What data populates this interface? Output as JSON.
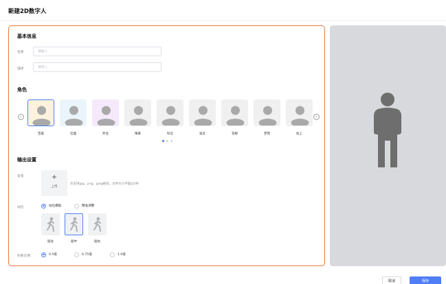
{
  "page": {
    "title": "新建2D数字人"
  },
  "basic_info": {
    "title": "基本信息",
    "name_label": "名称",
    "name_value": "",
    "name_placeholder": "请输入",
    "desc_label": "描述",
    "desc_value": "",
    "desc_placeholder": "请录入"
  },
  "role": {
    "title": "角色",
    "selected": "百富",
    "page_count": 3,
    "active_page": 1,
    "avatars": [
      {
        "label": "百富",
        "bg": "#fdf3dc"
      },
      {
        "label": "云烟",
        "bg": "#eaf4fb"
      },
      {
        "label": "乔治",
        "bg": "#f5e9fb"
      },
      {
        "label": "晴来",
        "bg": "#f0f0f0"
      },
      {
        "label": "科云",
        "bg": "#f0f0f0"
      },
      {
        "label": "张云",
        "bg": "#f0f0f0"
      },
      {
        "label": "花柳",
        "bg": "#f0f0f0"
      },
      {
        "label": "梦苑",
        "bg": "#f0f0f0"
      },
      {
        "label": "佐上",
        "bg": "#f0f0f0"
      }
    ]
  },
  "output": {
    "title": "输出设置",
    "background_label": "背景",
    "upload_plus": "+",
    "upload_text": "上传",
    "upload_hint": "仅支持jpg、png、jpeg格式，文件大小不超过3M",
    "station_label": "站位",
    "station_modes": [
      {
        "label": "站位模板",
        "checked": true
      },
      {
        "label": "精准调整",
        "checked": false
      }
    ],
    "positions": [
      {
        "label": "居左",
        "selected": false
      },
      {
        "label": "居中",
        "selected": true
      },
      {
        "label": "居右",
        "selected": false
      }
    ],
    "scale_label": "形象比例",
    "scales": [
      {
        "label": "0.5倍",
        "checked": true
      },
      {
        "label": "0.75倍",
        "checked": false
      },
      {
        "label": "1.0倍",
        "checked": false
      }
    ]
  },
  "footer": {
    "cancel_label": "取消",
    "save_label": "保存"
  },
  "colors": {
    "accent": "#4f7ef7",
    "panel_border": "#e8763c",
    "preview_bg": "#d8d9dd",
    "figure": "#6e6e6e"
  },
  "icons": {
    "prev": "chevron-left-icon",
    "next": "chevron-right-icon",
    "preview_figure": "person-silhouette-icon",
    "position": "walking-person-icon"
  }
}
